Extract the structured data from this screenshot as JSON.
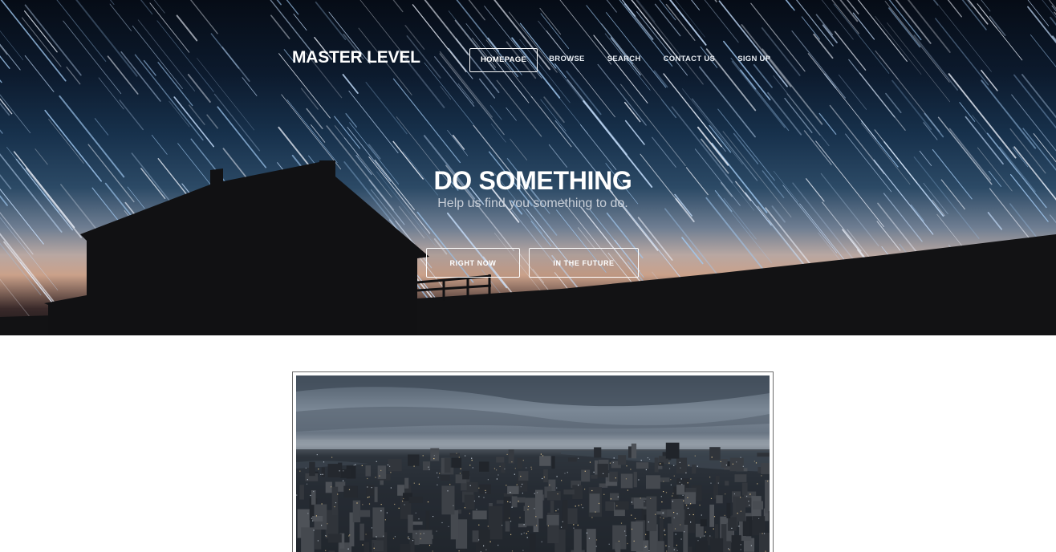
{
  "brand": "MASTER LEVEL",
  "nav": {
    "items": [
      {
        "label": "HOMEPAGE",
        "active": true
      },
      {
        "label": "BROWSE",
        "active": false
      },
      {
        "label": "SEARCH",
        "active": false
      },
      {
        "label": "CONTACT US",
        "active": false
      },
      {
        "label": "SIGN UP",
        "active": false
      }
    ]
  },
  "hero": {
    "title": "DO SOMETHING",
    "subtitle": "Help us find you something to do.",
    "buttons": {
      "right_now": "RIGHT NOW",
      "in_the_future": "IN THE FUTURE"
    }
  },
  "colors": {
    "accent": "#ffffff",
    "hero_sky_top": "#060c16",
    "hero_sky_mid": "#2c4a66",
    "silhouette": "#121214"
  }
}
